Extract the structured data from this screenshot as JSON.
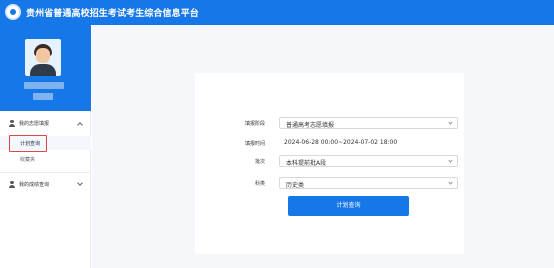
{
  "header": {
    "title": "贵州省普通高校招生考试考生综合信息平台",
    "colors": {
      "brand": "#1677e8"
    }
  },
  "sidebar": {
    "groups": [
      {
        "label": "我的志愿填报",
        "icon": "user-icon",
        "expanded": true,
        "items": [
          {
            "label": "计划查询",
            "active": true
          },
          {
            "label": "收藏夹",
            "active": false
          }
        ]
      },
      {
        "label": "我的成绩查询",
        "icon": "user-icon",
        "expanded": false,
        "items": []
      }
    ]
  },
  "form": {
    "fields": [
      {
        "label": "填报阶段",
        "value": "普通高考志愿填报",
        "type": "select"
      },
      {
        "label": "填报时间",
        "value": "2024-06-28 00:00~2024-07-02 18:00",
        "type": "text"
      },
      {
        "label": "批次",
        "value": "本科提前批A段",
        "type": "select"
      },
      {
        "label": "科类",
        "value": "历史类",
        "type": "select"
      }
    ],
    "submit_label": "计划查询"
  }
}
